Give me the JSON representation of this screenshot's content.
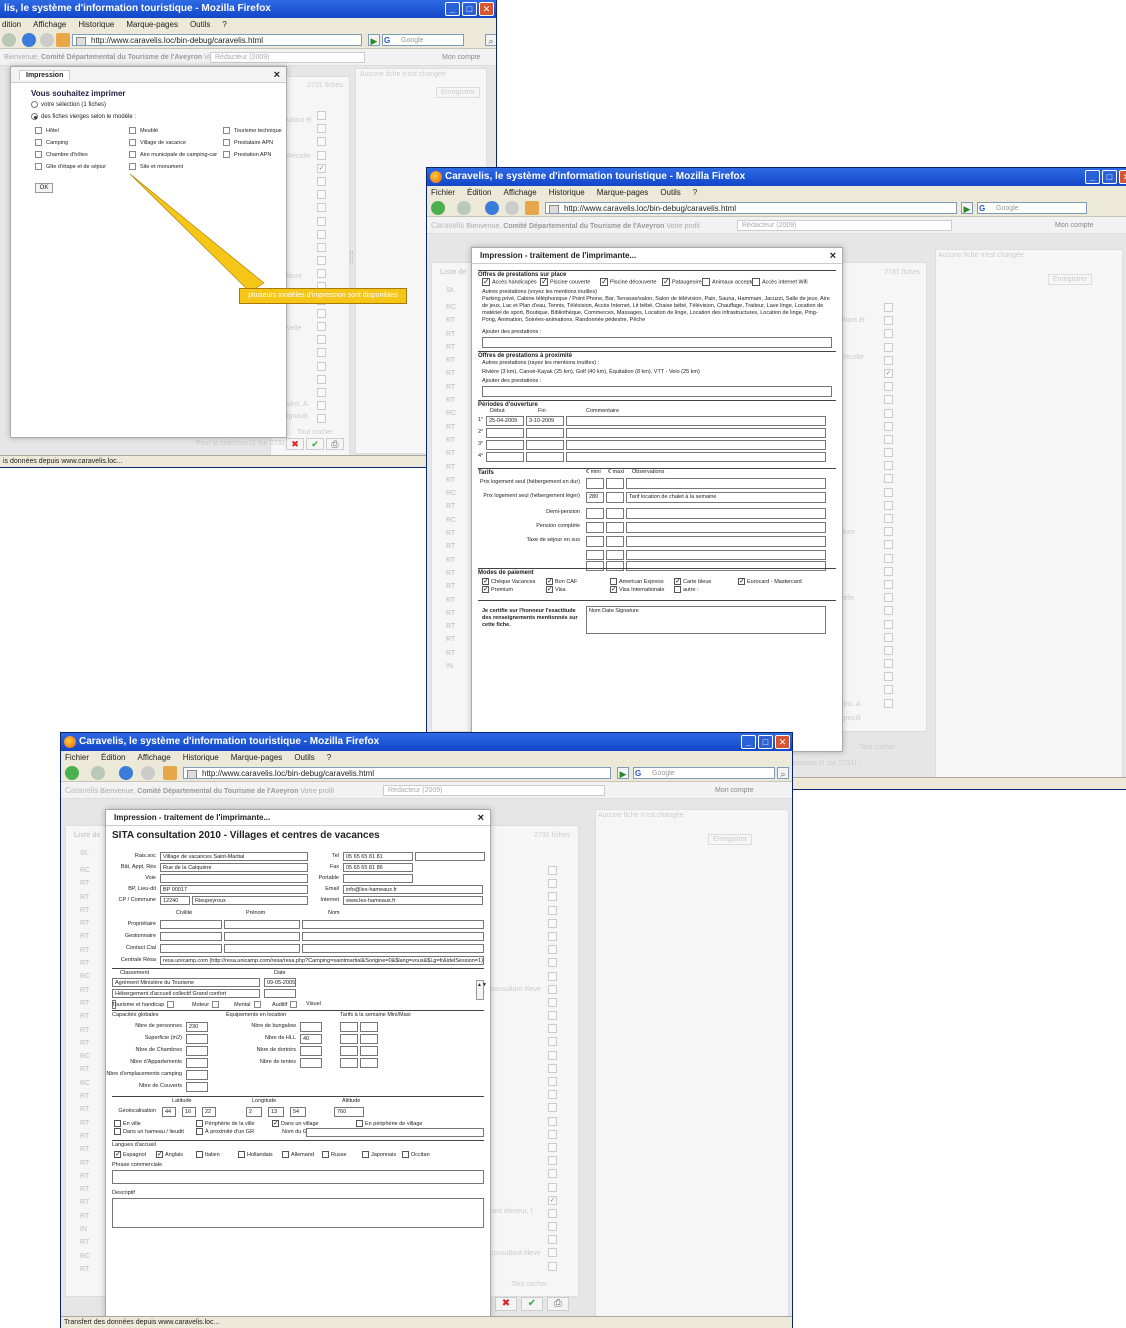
{
  "browser": {
    "title": "Caravelis, le système d'information touristique - Mozilla Firefox",
    "title_cut": "lis, le système d'information touristique - Mozilla Firefox",
    "menu": [
      "Fichier",
      "Édition",
      "Affichage",
      "Historique",
      "Marque-pages",
      "Outils",
      "?"
    ],
    "menu_cut": [
      "dition",
      "Affichage",
      "Historique",
      "Marque-pages",
      "Outils",
      "?"
    ],
    "url": "http://www.caravelis.loc/bin-debug/caravelis.html",
    "search_placeholder": "Google",
    "status": "Transfert des données depuis www.caravelis.loc...",
    "status_cut": "is données depuis www.caravelis.loc..."
  },
  "app": {
    "logo": "Caravelis",
    "welcome": "Bienvenue,",
    "org": "Comité Départemental du Tourisme de l'Aveyron",
    "profile_label": "Votre profil",
    "profile_value": "Rédacteur (2009)",
    "account": "Mon compte",
    "no_change": "Aucune fiche n'est changée",
    "count": "2731 fiches",
    "save": "Enregistrer",
    "list_title": "Liste de",
    "uncheck_all": "Tout cocher",
    "for_selection": "Pour la sélection (1 sur 2731) :",
    "st": "St.",
    "codes": [
      "RC",
      "RT",
      "RT",
      "RT",
      "RT",
      "RT",
      "RT",
      "RT",
      "RC",
      "RT",
      "RT",
      "RT",
      "RT",
      "RT",
      "RC",
      "RT",
      "RC",
      "RT",
      "RT",
      "RT",
      "RT",
      "RT",
      "RT",
      "RT",
      "RT",
      "RT",
      "RT",
      "IN",
      "RT",
      "RC",
      "RT"
    ],
    "bg_texts": [
      "ultant él",
      "Récolte",
      "liture",
      "velle",
      "dille",
      "vins. A",
      "ignoult",
      "bonsultant éleve",
      "ront éleveur, I",
      "consultant éleve"
    ]
  },
  "print_choice": {
    "tab": "Impression",
    "heading": "Vous souhaitez imprimer",
    "option_selection": "votre sélection (1 fiches)",
    "option_blank": "des fiches vierges selon le modèle :",
    "models": [
      "Hôtel",
      "Meublé",
      "Tourisme technique",
      "Camping",
      "Village de vacance",
      "Prestataire APN",
      "Chambre d'hôtes",
      "Aire municipale de camping-car",
      "Prestation APN",
      "Gîte d'étape et de séjour",
      "Site et monument"
    ],
    "ok": "OK",
    "tooltip": "plusieurs modèles d'impression sont disponibles"
  },
  "print_services": {
    "title": "Impression - traitement de l'imprimante...",
    "offres_title": "Offres de prestations sur place",
    "offres": [
      {
        "label": "Accès handicapés",
        "checked": true
      },
      {
        "label": "Piscine couverte",
        "checked": true
      },
      {
        "label": "Piscine découverte",
        "checked": true
      },
      {
        "label": "Pataugeoire",
        "checked": true
      },
      {
        "label": "Animaux acceptés",
        "checked": false
      },
      {
        "label": "Accès internet Wifi",
        "checked": false
      }
    ],
    "autres_label": "Autres prestations (voyez les mentions inutiles)",
    "autres_text": "Parking privé, Cabine téléphonique / Point Phone, Bar, Terrasse/salon, Salon de télévision, Pain, Sauna, Hammam, Jacuzzi, Salle de jeux, Aire de jeux, Lac et Plan d'eau, Tennis, Télévision, Accès Internet, Lit bébé, Chaise bébé, Télévision, Chauffage, Traiteur, Lave linge, Location de matériel de sport, Boutique, Bibliothèque, Commerces, Massages, Location de linge, Location des infrastructures, Location de linge, Ping-Pong, Animation, Soirées-animations, Randonnée pédestre, Pêche",
    "ajouter": "Ajouter des prestations :",
    "proximite_title": "Offres de prestations à proximité",
    "proximite_autres": "Autres prestations (rayez les mentions inutiles) :",
    "proximite_text": "Rivière (3 km), Canoë-Kayak (25 km), Golf (40 km), Équitation (8 km), VTT - Velo (25 km)",
    "periodes_title": "Périodes d'ouverture",
    "periodes_cols": [
      "Début",
      "Fin",
      "Commentaire"
    ],
    "periodes": [
      {
        "n": "1°",
        "debut": "25-04-2009",
        "fin": "3-10-2009"
      },
      {
        "n": "2°",
        "debut": "",
        "fin": ""
      },
      {
        "n": "3°",
        "debut": "",
        "fin": ""
      },
      {
        "n": "4°",
        "debut": "",
        "fin": ""
      }
    ],
    "tarifs_title": "Tarifs",
    "tarifs_cols": [
      "€ mini",
      "€ maxi",
      "Observations"
    ],
    "tarifs": [
      {
        "label": "Prix logement seul (hébergement en dur)",
        "mini": "",
        "maxi": "",
        "obs": ""
      },
      {
        "label": "Prix logement seul (hébergement léger)",
        "mini": "280",
        "maxi": "",
        "obs": "Tarif location de chalet à la semaine"
      },
      {
        "label": "Demi-pension",
        "mini": "",
        "maxi": "",
        "obs": ""
      },
      {
        "label": "Pension complète",
        "mini": "",
        "maxi": "",
        "obs": ""
      },
      {
        "label": "Taxe de séjour en sus",
        "mini": "",
        "maxi": "",
        "obs": ""
      }
    ],
    "paiement_title": "Modes de paiement",
    "paiements": [
      {
        "label": "Chèque Vacances",
        "checked": true
      },
      {
        "label": "Bon CAF",
        "checked": true
      },
      {
        "label": "American Express",
        "checked": false
      },
      {
        "label": "Carte bleue",
        "checked": true
      },
      {
        "label": "Eurocard - Mastercard",
        "checked": true
      },
      {
        "label": "Premium",
        "checked": true
      },
      {
        "label": "Visa",
        "checked": true
      },
      {
        "label": "Visa Internationale",
        "checked": true
      },
      {
        "label": "autre :",
        "checked": false
      }
    ],
    "certifie": "Je certifie sur l'honneur l'exactitude des renseignements mentionnés sur cette fiche.",
    "signature": "Nom Date Signature"
  },
  "print_consult": {
    "title": "Impression - traitement de l'imprimante...",
    "heading": "SITA consultation 2010 - Villages et centres de vacances",
    "raison_sociale": {
      "label": "Rais.soc",
      "value": "Village de vacances Saint-Martial"
    },
    "batiment": {
      "label": "Bât, Appt, Rés",
      "value": "Rue de la Calquière"
    },
    "voie": {
      "label": "Voie",
      "value": ""
    },
    "bp": {
      "label": "BP, Lieu-dit",
      "value": "BP 00017"
    },
    "cp": {
      "label": "CP / Commune",
      "value": "12240",
      "commune": "Rieupeyroux"
    },
    "tel": {
      "label": "Tel",
      "value": "05 65 65 81 81"
    },
    "fax": {
      "label": "Fax",
      "value": "05 65 65 81 86"
    },
    "portable": {
      "label": "Portable",
      "value": ""
    },
    "email": {
      "label": "Email",
      "value": "info@les-hameaux.fr"
    },
    "internet": {
      "label": "Internet",
      "value": "www.les-hameaux.fr"
    },
    "contact_cols": [
      "Civilité",
      "Prénom",
      "Nom"
    ],
    "contacts": [
      "Propriétaire",
      "Gestionnaire",
      "Contact Cial"
    ],
    "centrale_label": "Centrale Résa",
    "centrale_value": "resa.unicamp.com (http://resa.unicamp.com/resa/resa.php?Camping=saintmartial&Sorigine=0&$lang=vous&$Lg=fr&idelSession=1)",
    "classement_label": "Classement",
    "date_label": "Date",
    "classement_rows": [
      {
        "value": "Agrément Ministère du Tourisme",
        "date": "09-05-2005"
      },
      {
        "value": "Hébergement d'accueil collectif Grand confort",
        "date": ""
      }
    ],
    "handicap": [
      "Tourisme et handicap",
      "Moteur",
      "Mental",
      "Auditif",
      "Visuel"
    ],
    "capacites_title": "Capacités globales",
    "capacites": [
      {
        "label": "Nbre de personnes",
        "value": "230"
      },
      {
        "label": "Superficie (m2)",
        "value": ""
      },
      {
        "label": "Nbre de Chambres",
        "value": ""
      },
      {
        "label": "Nbre d'Appartements",
        "value": ""
      },
      {
        "label": "Nbre d'emplacements camping",
        "value": ""
      },
      {
        "label": "Nbre de Couverts",
        "value": ""
      }
    ],
    "equip_title": "Équipements en location",
    "equip": [
      {
        "label": "Nbre de bungalow",
        "value": ""
      },
      {
        "label": "Nbre de HLL",
        "value": "40"
      },
      {
        "label": "Nbre de dortoirs",
        "value": ""
      },
      {
        "label": "Nbre de tentes",
        "value": ""
      }
    ],
    "tarifs_title": "Tarifs à la semaine Mini/Maxi",
    "geo_cols": [
      "Latitude",
      "Longitude",
      "Altitude"
    ],
    "geo_label": "Géolocalisation",
    "lat": [
      "44",
      "16",
      "22"
    ],
    "lon": [
      "2",
      "13",
      "54"
    ],
    "alt": "760",
    "situation": [
      {
        "label": "En ville",
        "checked": false
      },
      {
        "label": "Périphérie de la ville",
        "checked": false
      },
      {
        "label": "Dans un village",
        "checked": true
      },
      {
        "label": "En périphérie de village",
        "checked": false
      },
      {
        "label": "Dans un hameau / lieudit",
        "checked": false
      },
      {
        "label": "À proximité d'un GR",
        "checked": false
      }
    ],
    "gr_label": "Nom du GR",
    "langues_title": "Langues d'accueil",
    "langues": [
      {
        "label": "Espagnol",
        "checked": true
      },
      {
        "label": "Anglais",
        "checked": true
      },
      {
        "label": "Italien",
        "checked": false
      },
      {
        "label": "Hollandais",
        "checked": false
      },
      {
        "label": "Allemand",
        "checked": false
      },
      {
        "label": "Russe",
        "checked": false
      },
      {
        "label": "Japonnais",
        "checked": false
      },
      {
        "label": "Occitan",
        "checked": false
      }
    ],
    "phrase_label": "Phrase commerciale",
    "descriptif_label": "Descriptif"
  },
  "colors": {
    "xp_blue": "#1146c8",
    "tooltip": "#f5c518",
    "firefox_orange": "#e0601a"
  }
}
